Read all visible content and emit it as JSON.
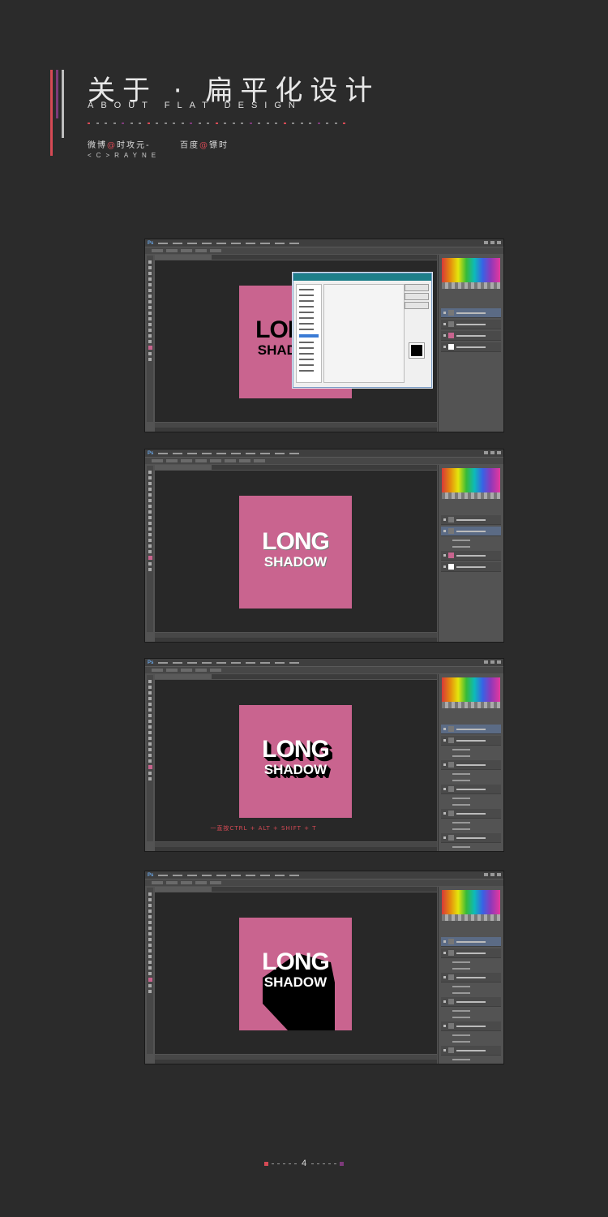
{
  "header": {
    "title_cn": "关于 · 扁平化设计",
    "title_en": "ABOUT   FLAT   DESIGN",
    "credit_weibo_prefix": "微博",
    "credit_weibo_at": "@",
    "credit_weibo_name": "时攻元-",
    "credit_baidu_prefix": "百度",
    "credit_baidu_at": "@",
    "credit_baidu_name": "镖时",
    "signature": "<C>RAYNE"
  },
  "colors": {
    "accent_red": "#d64a55",
    "accent_purple": "#7d3a7a",
    "canvas_pink": "#c9648f",
    "background": "#2b2b2b"
  },
  "screens": [
    {
      "step": 1,
      "art_line1": "LONG",
      "art_line2": "SHADOW",
      "text_color": "#000000",
      "shadow": "none",
      "dialog_open": true
    },
    {
      "step": 2,
      "art_line1": "LONG",
      "art_line2": "SHADOW",
      "text_color": "#ffffff",
      "shadow": "single",
      "dialog_open": false
    },
    {
      "step": 3,
      "art_line1": "LONG",
      "art_line2": "SHADOW",
      "text_color": "#ffffff",
      "shadow": "stepped",
      "dialog_open": false
    },
    {
      "step": 4,
      "art_line1": "LONG",
      "art_line2": "SHADOW",
      "text_color": "#ffffff",
      "shadow": "long",
      "dialog_open": false
    }
  ],
  "hint": "一直按CTRL + ALT + SHIFT + T",
  "pager": {
    "number": "4"
  }
}
